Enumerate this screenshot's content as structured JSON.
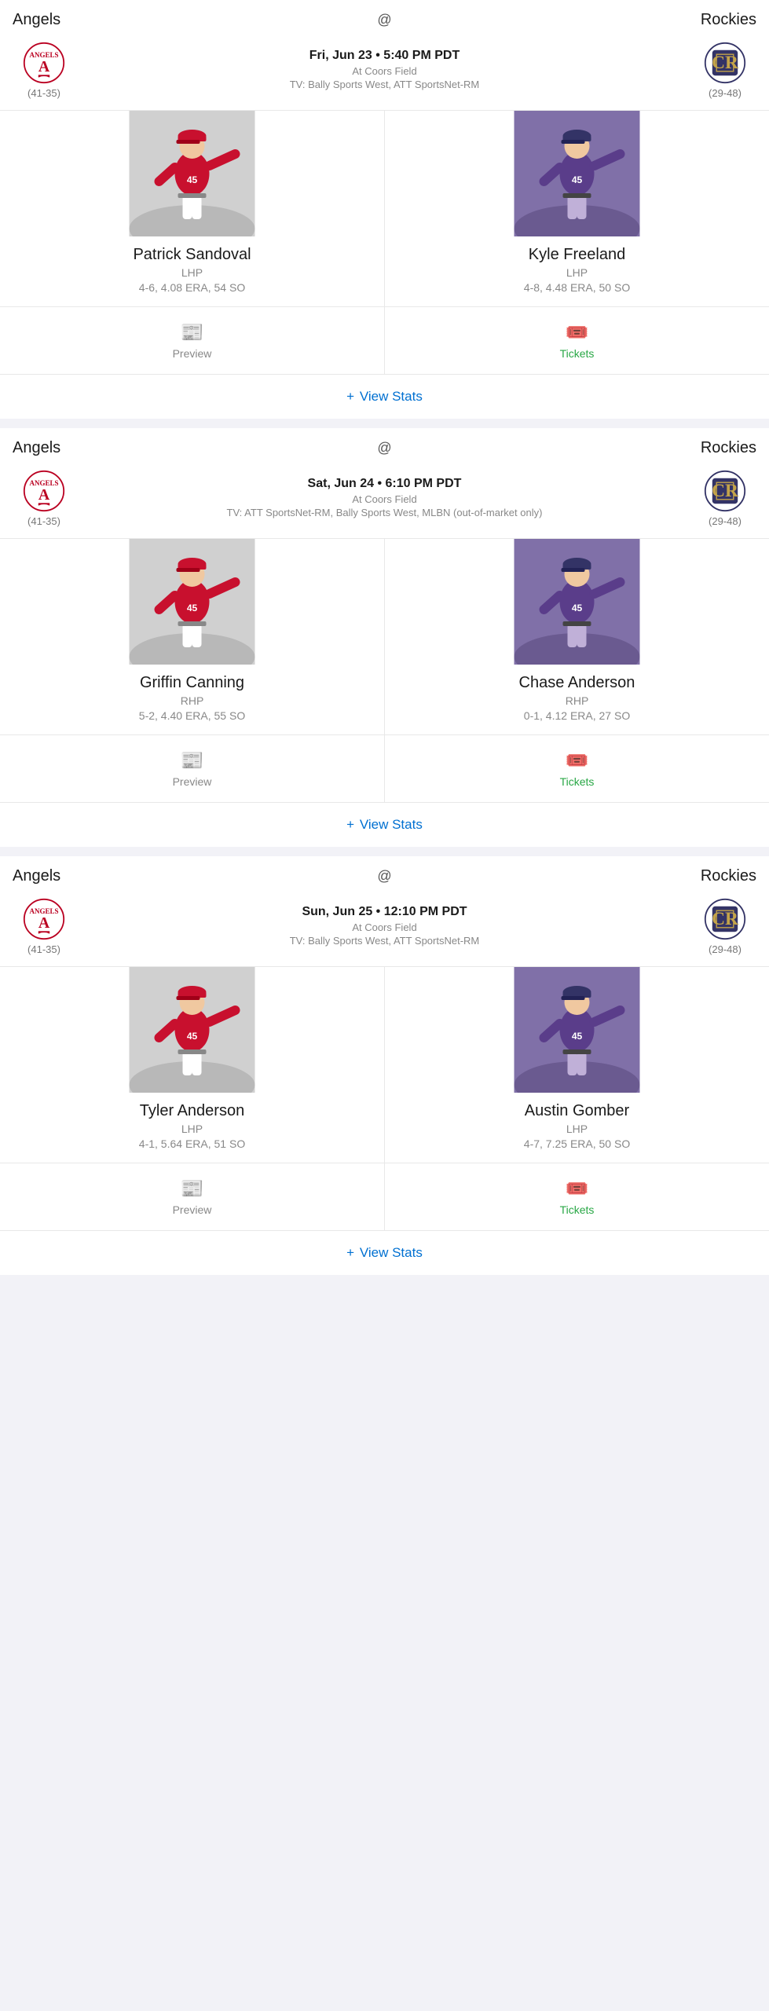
{
  "games": [
    {
      "id": "game-1",
      "away_team": "Angels",
      "home_team": "Rockies",
      "away_record": "(41-35)",
      "home_record": "(29-48)",
      "date_time": "Fri, Jun 23 • 5:40 PM PDT",
      "venue": "At Coors Field",
      "tv": "TV: Bally Sports West, ATT SportsNet-RM",
      "away_pitcher_name": "Patrick Sandoval",
      "away_pitcher_pos": "LHP",
      "away_pitcher_stats": "4-6, 4.08 ERA, 54 SO",
      "away_pitcher_class": "angels-1",
      "home_pitcher_name": "Kyle Freeland",
      "home_pitcher_pos": "LHP",
      "home_pitcher_stats": "4-8, 4.48 ERA, 50 SO",
      "home_pitcher_class": "rockies-1",
      "preview_label": "Preview",
      "tickets_label": "Tickets",
      "view_stats_label": "View Stats"
    },
    {
      "id": "game-2",
      "away_team": "Angels",
      "home_team": "Rockies",
      "away_record": "(41-35)",
      "home_record": "(29-48)",
      "date_time": "Sat, Jun 24 • 6:10 PM PDT",
      "venue": "At Coors Field",
      "tv": "TV: ATT SportsNet-RM, Bally Sports West, MLBN (out-of-market only)",
      "away_pitcher_name": "Griffin Canning",
      "away_pitcher_pos": "RHP",
      "away_pitcher_stats": "5-2, 4.40 ERA, 55 SO",
      "away_pitcher_class": "angels-2",
      "home_pitcher_name": "Chase Anderson",
      "home_pitcher_pos": "RHP",
      "home_pitcher_stats": "0-1, 4.12 ERA, 27 SO",
      "home_pitcher_class": "rockies-2",
      "preview_label": "Preview",
      "tickets_label": "Tickets",
      "view_stats_label": "View Stats"
    },
    {
      "id": "game-3",
      "away_team": "Angels",
      "home_team": "Rockies",
      "away_record": "(41-35)",
      "home_record": "(29-48)",
      "date_time": "Sun, Jun 25 • 12:10 PM PDT",
      "venue": "At Coors Field",
      "tv": "TV: Bally Sports West, ATT SportsNet-RM",
      "away_pitcher_name": "Tyler Anderson",
      "away_pitcher_pos": "LHP",
      "away_pitcher_stats": "4-1, 5.64 ERA, 51 SO",
      "away_pitcher_class": "angels-3",
      "home_pitcher_name": "Austin Gomber",
      "home_pitcher_pos": "LHP",
      "home_pitcher_stats": "4-7, 7.25 ERA, 50 SO",
      "home_pitcher_class": "rockies-3",
      "preview_label": "Preview",
      "tickets_label": "Tickets",
      "view_stats_label": "View Stats"
    }
  ],
  "icons": {
    "preview": "📰",
    "tickets": "🎟️",
    "plus": "+"
  }
}
